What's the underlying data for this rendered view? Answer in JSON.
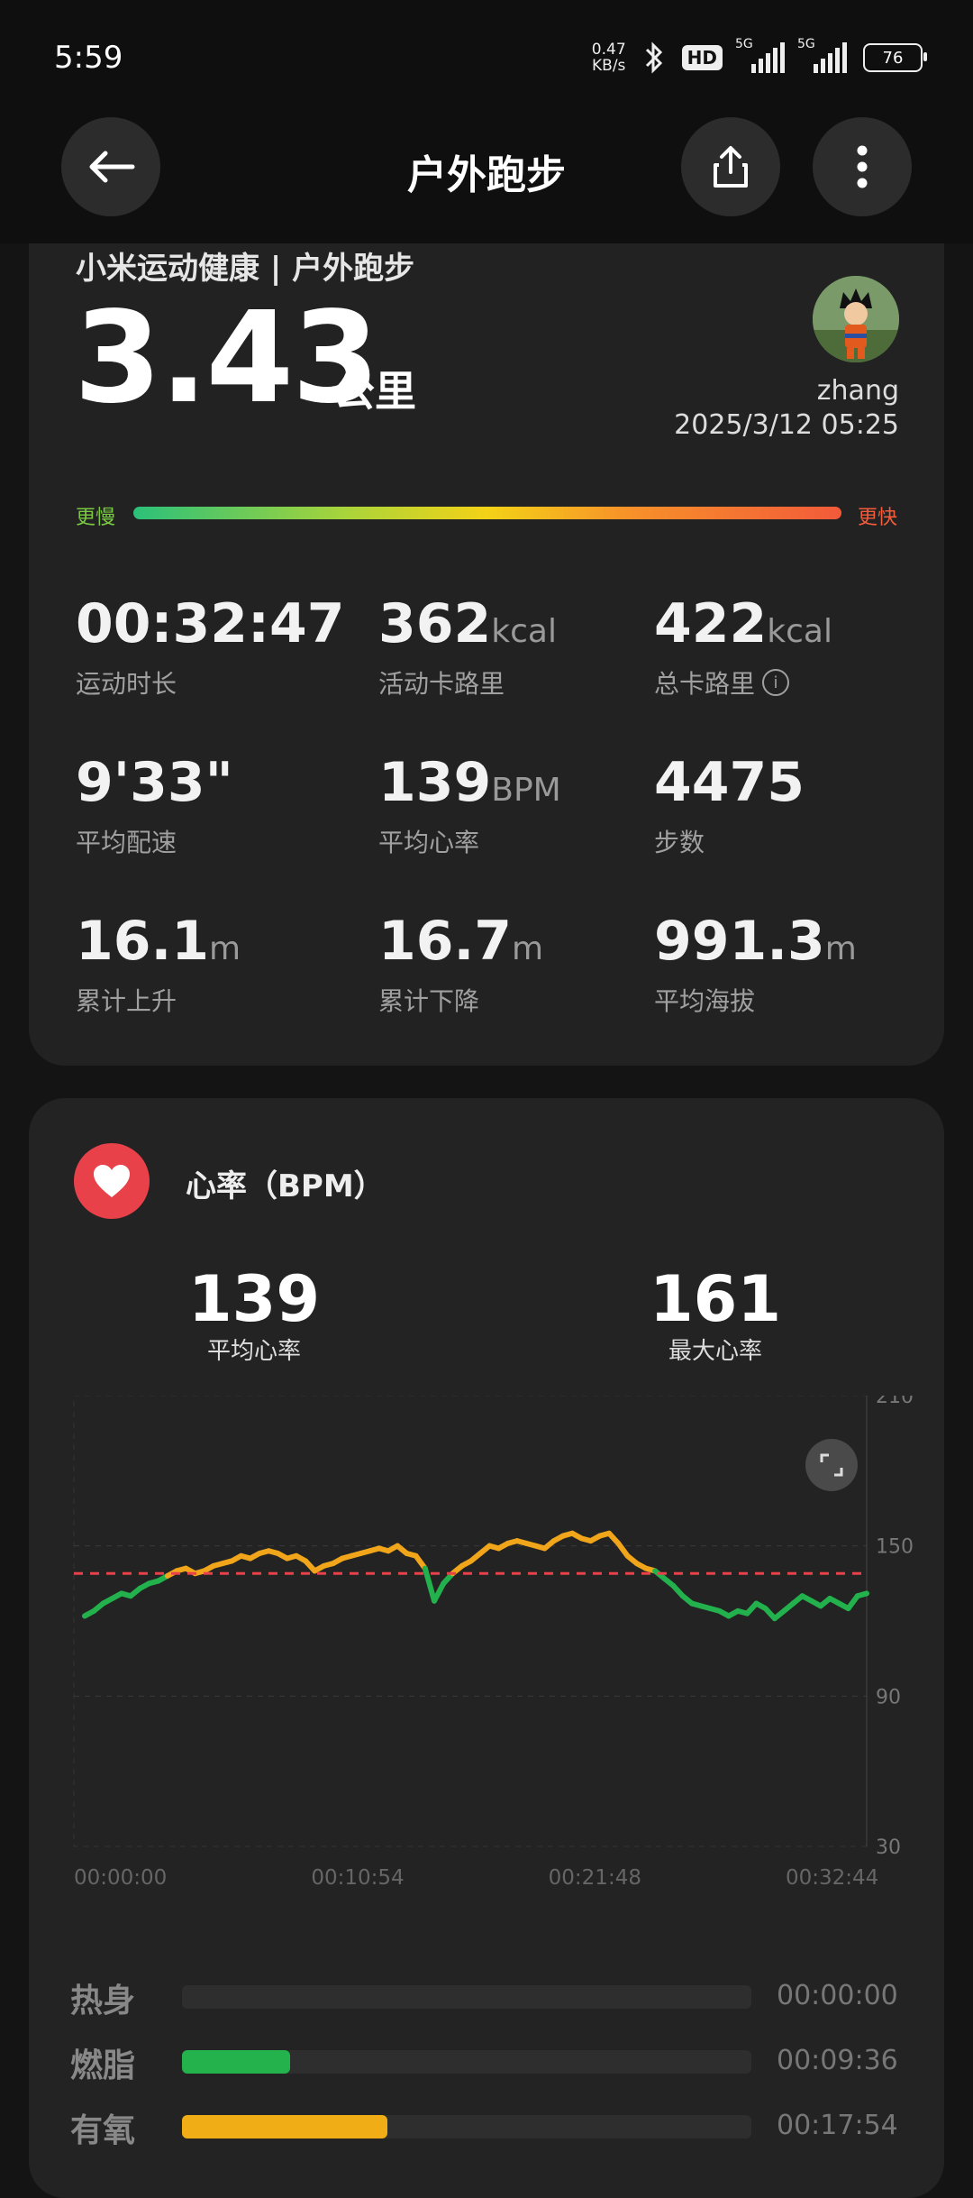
{
  "status": {
    "time": "5:59",
    "net_speed_value": "0.47",
    "net_speed_unit": "KB/s",
    "hd_label": "HD",
    "sig1_label": "5G",
    "sig2_label": "5G",
    "battery": "76"
  },
  "appbar": {
    "title": "户外跑步"
  },
  "summary": {
    "source": "小米运动健康 | 户外跑步",
    "distance": "3.43",
    "distance_unit": "公里",
    "username": "zhang",
    "datetime": "2025/3/12 05:25",
    "slower": "更慢",
    "faster": "更快"
  },
  "metrics": [
    {
      "value": "00:32:47",
      "unit": "",
      "label": "运动时长"
    },
    {
      "value": "362",
      "unit": "kcal",
      "label": "活动卡路里"
    },
    {
      "value": "422",
      "unit": "kcal",
      "label": "总卡路里"
    },
    {
      "value": "9'33\"",
      "unit": "",
      "label": "平均配速"
    },
    {
      "value": "139",
      "unit": "BPM",
      "label": "平均心率"
    },
    {
      "value": "4475",
      "unit": "",
      "label": "步数"
    },
    {
      "value": "16.1",
      "unit": "m",
      "label": "累计上升"
    },
    {
      "value": "16.7",
      "unit": "m",
      "label": "累计下降"
    },
    {
      "value": "991.3",
      "unit": "m",
      "label": "平均海拔"
    }
  ],
  "heart_rate": {
    "title": "心率（BPM）",
    "avg_value": "139",
    "avg_label": "平均心率",
    "max_value": "161",
    "max_label": "最大心率"
  },
  "chart_data": {
    "type": "line",
    "title": "",
    "xlabel": "",
    "ylabel": "",
    "x_tick_labels": [
      "00:00:00",
      "00:10:54",
      "00:21:48",
      "00:32:44"
    ],
    "y_tick_labels": [
      "210",
      "150",
      "90",
      "30"
    ],
    "ylim": [
      30,
      210
    ],
    "reference_line": 139,
    "grid": true,
    "series": [
      {
        "values": [
          122,
          124,
          127,
          129,
          131,
          130,
          133,
          135,
          136,
          138,
          140,
          141,
          139,
          140,
          142,
          143,
          144,
          146,
          145,
          147,
          148,
          147,
          145,
          146,
          144,
          140,
          142,
          143,
          145,
          146,
          147,
          148,
          149,
          148,
          150,
          147,
          146,
          141,
          128,
          135,
          139,
          142,
          144,
          147,
          150,
          149,
          151,
          152,
          151,
          150,
          149,
          152,
          154,
          155,
          153,
          152,
          154,
          155,
          151,
          146,
          143,
          141,
          140,
          137,
          134,
          130,
          127,
          126,
          125,
          124,
          122,
          124,
          123,
          127,
          125,
          121,
          124,
          127,
          130,
          128,
          126,
          129,
          127,
          125,
          130,
          131
        ]
      }
    ]
  },
  "zones": [
    {
      "name": "热身",
      "time": "00:00:00",
      "fraction": 0.0,
      "color": "#23b24b"
    },
    {
      "name": "燃脂",
      "time": "00:09:36",
      "fraction": 0.19,
      "color": "#23b24b"
    },
    {
      "name": "有氧",
      "time": "00:17:54",
      "fraction": 0.36,
      "color": "#f0ad16"
    }
  ],
  "colors": {
    "hr_above": "#f0a51a",
    "hr_below": "#22b14c",
    "reference": "#e8414a",
    "heart_icon_bg": "#e8414a"
  },
  "icons": {
    "back": "back-arrow-icon",
    "share": "share-icon",
    "more": "more-vertical-icon",
    "heart": "heart-icon",
    "expand": "expand-icon",
    "info": "info-icon"
  }
}
